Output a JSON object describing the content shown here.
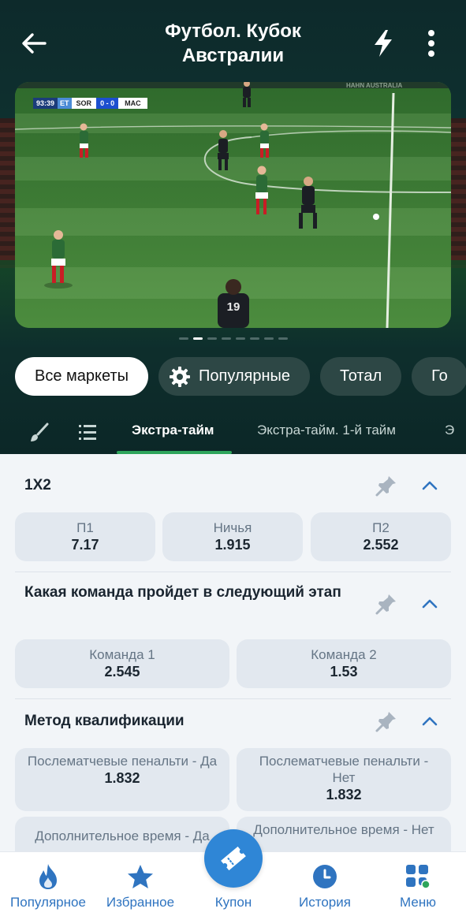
{
  "header": {
    "title": "Футбол. Кубок Австралии"
  },
  "video": {
    "scorebug": {
      "time": "93:39",
      "period": "ET",
      "team1": "SOR",
      "score": "0 - 0",
      "team2": "MAC"
    },
    "board_text": "HAHN AUSTRALIA",
    "player_number": "19",
    "slide_count": 8,
    "active_slide": 2
  },
  "chips": [
    {
      "label": "Все маркеты",
      "active": true
    },
    {
      "label": "Популярные",
      "icon": "gear-icon"
    },
    {
      "label": "Тотал"
    },
    {
      "label": "Го"
    }
  ],
  "tabs": [
    {
      "label": "Экстра-тайм",
      "active": true
    },
    {
      "label": "Экстра-тайм. 1-й тайм"
    },
    {
      "label": "Э"
    }
  ],
  "markets": [
    {
      "title": "1X2",
      "odds": [
        {
          "label": "П1",
          "value": "7.17"
        },
        {
          "label": "Ничья",
          "value": "1.915"
        },
        {
          "label": "П2",
          "value": "2.552"
        }
      ]
    },
    {
      "title": "Какая команда пройдет в следующий этап",
      "odds": [
        {
          "label": "Команда 1",
          "value": "2.545"
        },
        {
          "label": "Команда 2",
          "value": "1.53"
        }
      ]
    },
    {
      "title": "Метод квалификации",
      "odds": [
        {
          "label": "Послематчевые пенальти - Да",
          "value": "1.832"
        },
        {
          "label": "Послематчевые пенальти - Нет",
          "value": "1.832"
        },
        {
          "label": "Дополнительное время - Да",
          "value": ""
        },
        {
          "label": "Дополнительное время - Нет",
          "value": ""
        }
      ]
    }
  ],
  "nav": {
    "items": [
      {
        "label": "Популярное",
        "icon": "flame-icon"
      },
      {
        "label": "Избранное",
        "icon": "star-icon"
      },
      {
        "label": "Купон",
        "icon": "ticket-icon"
      },
      {
        "label": "История",
        "icon": "clock-icon"
      },
      {
        "label": "Меню",
        "icon": "grid-icon",
        "active": true
      }
    ]
  },
  "colors": {
    "header_bg": "#0f3331",
    "accent_green": "#2ea55b",
    "nav_blue": "#2f74c0",
    "coupon_blue": "#2f86d6",
    "odd_bg": "#e2e8ef"
  }
}
